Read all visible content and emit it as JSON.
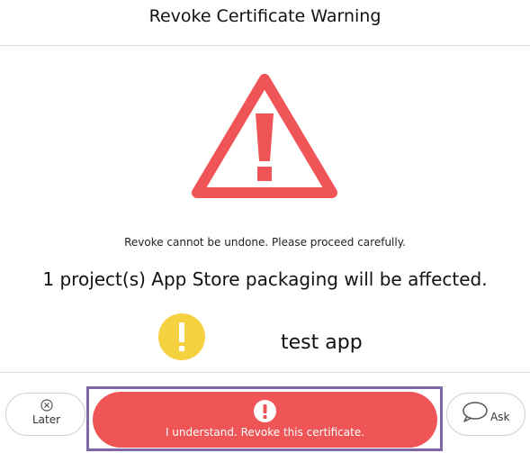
{
  "header": {
    "title": "Revoke Certificate Warning"
  },
  "body": {
    "warning_icon": "warning-triangle-icon",
    "caution": "Revoke cannot be undone. Please proceed carefully.",
    "affected": "1 project(s) App Store packaging will be affected.",
    "project": {
      "icon": "warning-circle-icon",
      "name": "test app"
    }
  },
  "footer": {
    "later": {
      "icon": "close-circle-icon",
      "label": "Later"
    },
    "revoke": {
      "icon": "exclamation-circle-icon",
      "label": "I understand. Revoke this certificate."
    },
    "ask": {
      "icon": "speech-bubble-icon",
      "label": "Ask"
    }
  },
  "colors": {
    "danger": "#ef5456",
    "warning_yellow": "#f6d13f",
    "highlight": "#7f69a5",
    "divider": "#dedede"
  }
}
